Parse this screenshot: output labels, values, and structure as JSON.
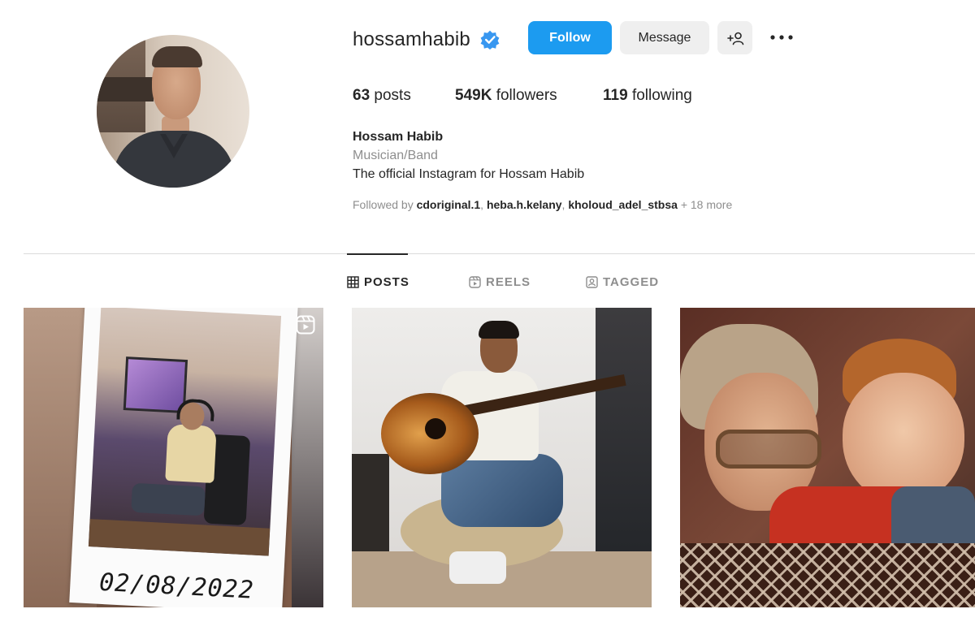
{
  "profile": {
    "username": "hossamhabib",
    "verified": true,
    "full_name": "Hossam Habib",
    "category": "Musician/Band",
    "bio": "The official Instagram for Hossam Habib"
  },
  "actions": {
    "follow_label": "Follow",
    "message_label": "Message",
    "add_user_icon": "add-user-icon",
    "more_icon": "more-horizontal-icon"
  },
  "stats": {
    "posts_count": "63",
    "posts_label": "posts",
    "followers_count": "549K",
    "followers_label": "followers",
    "following_count": "119",
    "following_label": "following"
  },
  "followed_by": {
    "prefix": "Followed by",
    "accounts": [
      "cdoriginal.1",
      "heba.h.kelany",
      "kholoud_adel_stbsa"
    ],
    "separator": ", ",
    "more": "+ 18 more"
  },
  "tabs": [
    {
      "label": "POSTS",
      "icon": "grid-icon",
      "active": true
    },
    {
      "label": "REELS",
      "icon": "reels-icon",
      "active": false
    },
    {
      "label": "TAGGED",
      "icon": "tagged-icon",
      "active": false
    }
  ],
  "posts": [
    {
      "type": "reel",
      "overlay_text": "02/08/2022",
      "badge_icon": "reel-badge-icon"
    },
    {
      "type": "photo"
    },
    {
      "type": "photo"
    }
  ],
  "colors": {
    "accent": "#1c9bf0",
    "text": "#262626",
    "muted": "#8e8e8e",
    "divider": "#dbdbdb"
  }
}
